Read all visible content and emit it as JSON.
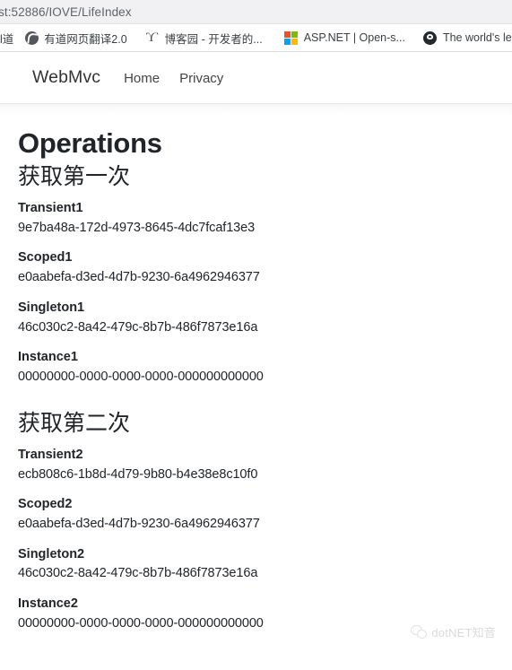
{
  "browser": {
    "url": "st:52886/IOVE/LifeIndex",
    "bookmarks": [
      {
        "label": "l道",
        "icon": "cut-off-bookmark-icon"
      },
      {
        "label": "有道网页翻译2.0",
        "icon": "globe-icon"
      },
      {
        "label": "博客园 - 开发者的...",
        "icon": "cnblogs-icon"
      },
      {
        "label": "ASP.NET | Open-s...",
        "icon": "microsoft-icon"
      },
      {
        "label": "The world's le",
        "icon": "github-icon"
      }
    ]
  },
  "site_nav": {
    "brand": "WebMvc",
    "links": [
      {
        "label": "Home"
      },
      {
        "label": "Privacy"
      }
    ]
  },
  "page": {
    "title": "Operations",
    "sections": [
      {
        "heading": "获取第一次",
        "fields": [
          {
            "label": "Transient1",
            "value": "9e7ba48a-172d-4973-8645-4dc7fcaf13e3"
          },
          {
            "label": "Scoped1",
            "value": "e0aabefa-d3ed-4d7b-9230-6a4962946377"
          },
          {
            "label": "Singleton1",
            "value": "46c030c2-8a42-479c-8b7b-486f7873e16a"
          },
          {
            "label": "Instance1",
            "value": "00000000-0000-0000-0000-000000000000"
          }
        ]
      },
      {
        "heading": "获取第二次",
        "fields": [
          {
            "label": "Transient2",
            "value": "ecb808c6-1b8d-4d79-9b80-b4e38e8c10f0"
          },
          {
            "label": "Scoped2",
            "value": "e0aabefa-d3ed-4d7b-9230-6a4962946377"
          },
          {
            "label": "Singleton2",
            "value": "46c030c2-8a42-479c-8b7b-486f7873e16a"
          },
          {
            "label": "Instance2",
            "value": "00000000-0000-0000-0000-000000000000"
          }
        ]
      }
    ]
  },
  "watermark": {
    "text": "dotNET知音"
  },
  "colors": {
    "chrome_bg": "#f1f1f3",
    "url_text": "#5f6368",
    "body_text": "#212529",
    "ms_red": "#f25022",
    "ms_green": "#7fba00",
    "ms_blue": "#00a4ef",
    "ms_yellow": "#ffb900"
  }
}
